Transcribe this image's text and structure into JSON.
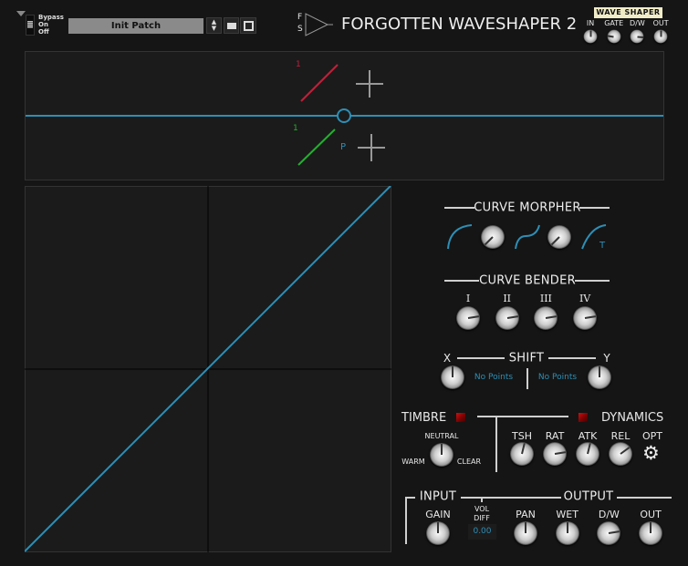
{
  "header": {
    "bypass": {
      "labels": [
        "Bypass",
        "On",
        "Off"
      ]
    },
    "patch_name": "Init Patch",
    "logo_letters": [
      "F",
      "S"
    ],
    "title": "FORGOTTEN WAVESHAPER 2",
    "badge": "WAVE SHAPER",
    "knobs": [
      {
        "label": "IN",
        "value": 0.5
      },
      {
        "label": "GATE",
        "value": 0.2
      },
      {
        "label": "D/W",
        "value": 0.85
      },
      {
        "label": "OUT",
        "value": 0.5
      }
    ]
  },
  "display": {
    "marker_top": "1",
    "marker_bottom": "1",
    "point_label": "P"
  },
  "curve_morpher": {
    "title": "CURVE MORPHER",
    "knob_values": [
      0.0,
      0.0
    ],
    "t_label": "T"
  },
  "curve_bender": {
    "title": "CURVE BENDER",
    "knobs": [
      {
        "label": "I",
        "value": 0.8
      },
      {
        "label": "II",
        "value": 0.8
      },
      {
        "label": "III",
        "value": 0.8
      },
      {
        "label": "IV",
        "value": 0.8
      }
    ]
  },
  "shift": {
    "title": "SHIFT",
    "x_label": "X",
    "y_label": "Y",
    "x_value": 0.5,
    "y_value": 0.5,
    "x_points": "No Points",
    "y_points": "No Points"
  },
  "timbre": {
    "title": "TIMBRE",
    "neutral": "NEUTRAL",
    "warm": "WARM",
    "clear": "CLEAR",
    "value": 0.5
  },
  "dynamics": {
    "title": "DYNAMICS",
    "knobs": [
      {
        "label": "TSH",
        "value": 0.55
      },
      {
        "label": "RAT",
        "value": 0.8
      },
      {
        "label": "ATK",
        "value": 0.55
      },
      {
        "label": "REL",
        "value": 0.7
      }
    ],
    "opt_label": "OPT"
  },
  "input": {
    "title": "INPUT",
    "gain_label": "GAIN",
    "gain_value": 0.5,
    "vol_diff_label": [
      "VOL",
      "DIFF"
    ],
    "vol_diff_value": "0.00"
  },
  "output": {
    "title": "OUTPUT",
    "knobs": [
      {
        "label": "PAN",
        "value": 0.5
      },
      {
        "label": "WET",
        "value": 0.5
      },
      {
        "label": "D/W",
        "value": 0.8
      },
      {
        "label": "OUT",
        "value": 0.5
      }
    ]
  },
  "colors": {
    "accent": "#2d8fb6",
    "red": "#c0203a",
    "green": "#22b030"
  }
}
